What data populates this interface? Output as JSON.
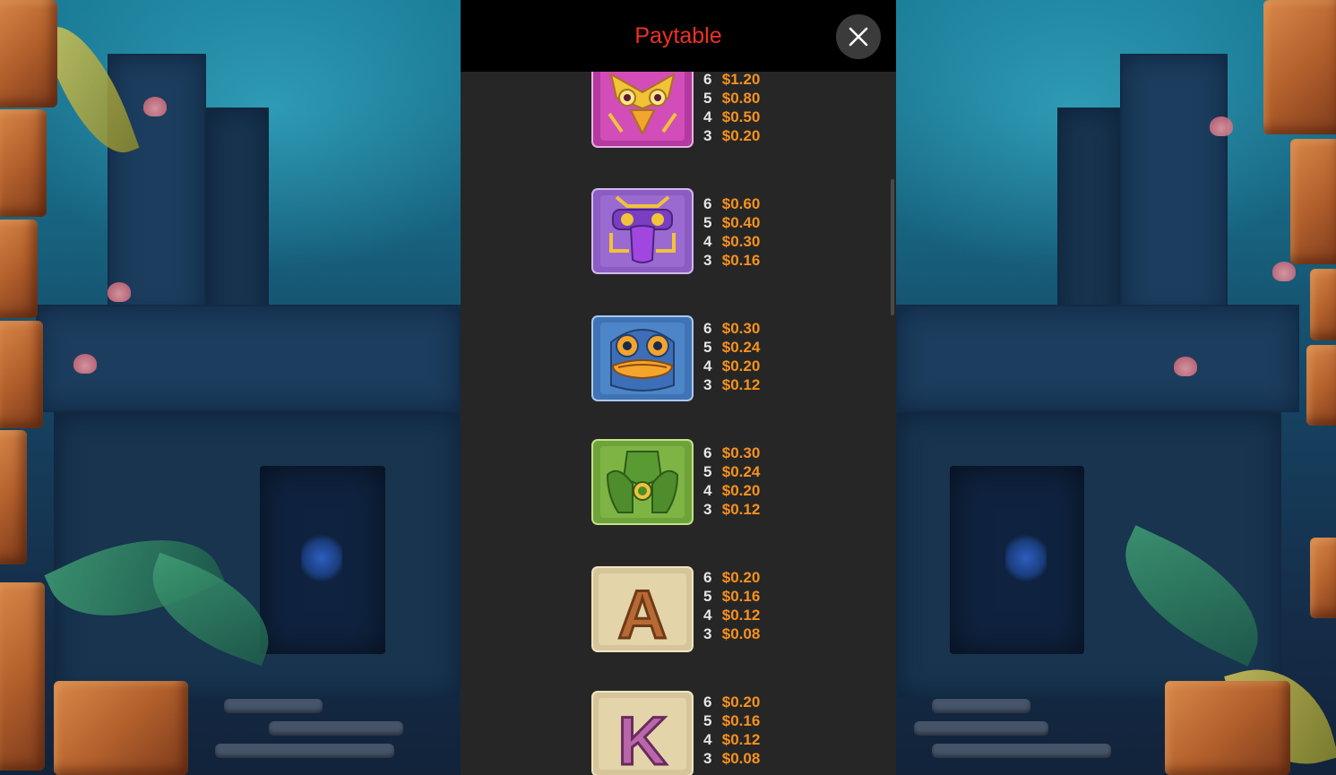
{
  "header": {
    "title": "Paytable"
  },
  "colors": {
    "title": "#ef3124",
    "payout_value": "#f6921e",
    "count": "#e6e6e6",
    "panel_bg": "#262626",
    "header_bg": "#000000"
  },
  "close_icon": "close-icon",
  "symbols": [
    {
      "name": "pink-bird-mask",
      "pays": [
        {
          "count": "6",
          "value": "$1.20"
        },
        {
          "count": "5",
          "value": "$0.80"
        },
        {
          "count": "4",
          "value": "$0.50"
        },
        {
          "count": "3",
          "value": "$0.20"
        }
      ]
    },
    {
      "name": "purple-mask",
      "pays": [
        {
          "count": "6",
          "value": "$0.60"
        },
        {
          "count": "5",
          "value": "$0.40"
        },
        {
          "count": "4",
          "value": "$0.30"
        },
        {
          "count": "3",
          "value": "$0.16"
        }
      ]
    },
    {
      "name": "blue-frog-mask",
      "pays": [
        {
          "count": "6",
          "value": "$0.30"
        },
        {
          "count": "5",
          "value": "$0.24"
        },
        {
          "count": "4",
          "value": "$0.20"
        },
        {
          "count": "3",
          "value": "$0.12"
        }
      ]
    },
    {
      "name": "green-idol",
      "pays": [
        {
          "count": "6",
          "value": "$0.30"
        },
        {
          "count": "5",
          "value": "$0.24"
        },
        {
          "count": "4",
          "value": "$0.20"
        },
        {
          "count": "3",
          "value": "$0.12"
        }
      ]
    },
    {
      "name": "letter-a",
      "letter": "A",
      "pays": [
        {
          "count": "6",
          "value": "$0.20"
        },
        {
          "count": "5",
          "value": "$0.16"
        },
        {
          "count": "4",
          "value": "$0.12"
        },
        {
          "count": "3",
          "value": "$0.08"
        }
      ]
    },
    {
      "name": "letter-k",
      "letter": "K",
      "pays": [
        {
          "count": "6",
          "value": "$0.20"
        },
        {
          "count": "5",
          "value": "$0.16"
        },
        {
          "count": "4",
          "value": "$0.12"
        },
        {
          "count": "3",
          "value": "$0.08"
        }
      ]
    }
  ]
}
